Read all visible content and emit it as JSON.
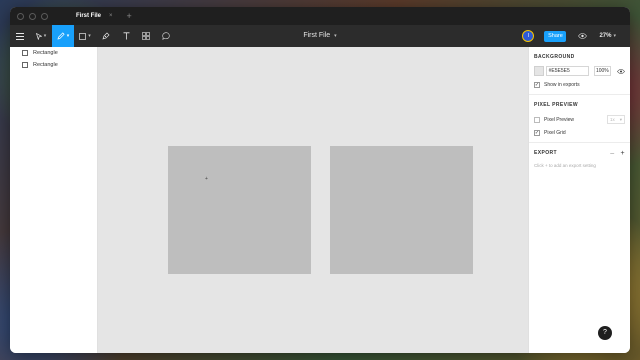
{
  "titlebar": {
    "tab_title": "First File",
    "tab_close": "×",
    "new_tab": "+"
  },
  "toolbar": {
    "file_title": "First File",
    "avatar_initial": "I",
    "share_label": "Share",
    "zoom_label": "27%",
    "active_tool": "pen",
    "icons": [
      "menu-icon",
      "move-icon",
      "frame-icon",
      "pen-icon",
      "pencil-icon",
      "text-icon",
      "components-icon",
      "comment-icon",
      "present-icon"
    ]
  },
  "layers": [
    {
      "name": "Rectangle"
    },
    {
      "name": "Rectangle"
    }
  ],
  "canvas": {
    "background": "#E5E5E5",
    "rect_color": "#BEBEBE",
    "cursor_glyph": "+"
  },
  "properties": {
    "background": {
      "title": "BACKGROUND",
      "hex": "#E5E5E5",
      "opacity": "100%",
      "show_in_exports_label": "Show in exports",
      "show_in_exports": true
    },
    "pixel_preview": {
      "title": "PIXEL PREVIEW",
      "pixel_preview_label": "Pixel Preview",
      "pixel_preview": false,
      "scale_value": "1x",
      "pixel_grid_label": "Pixel Grid",
      "pixel_grid": true
    },
    "export": {
      "title": "EXPORT",
      "minus": "–",
      "plus": "+",
      "hint": "Click + to add an export setting"
    }
  },
  "help": {
    "label": "?"
  },
  "colors": {
    "accent": "#18A0FB",
    "toolbar": "#2C2C2C",
    "titlebar": "#1F1F1F"
  }
}
